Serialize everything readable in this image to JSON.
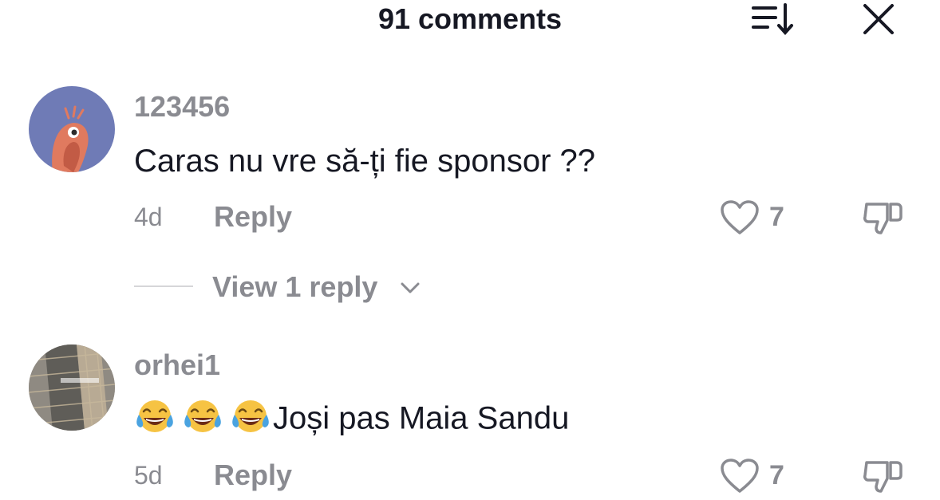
{
  "header": {
    "title": "91 comments",
    "sort_icon": "sort-down-icon",
    "close_icon": "close-icon"
  },
  "comments": [
    {
      "username": "123456",
      "text": "Caras nu vre să-ți fie sponsor ??",
      "time": "4d",
      "reply_label": "Reply",
      "likes": "7",
      "view_replies_label": "View 1 reply"
    },
    {
      "username": "orhei1",
      "emoji_count": 3,
      "emoji": "face-with-tears-of-joy",
      "text": "Joși pas Maia Sandu",
      "time": "5d",
      "reply_label": "Reply",
      "likes": "7"
    }
  ],
  "colors": {
    "text_primary": "#161823",
    "text_secondary": "#8a8b91",
    "avatar1_bg": "#6f7bb6",
    "avatar1_figure": "#e07a5f"
  }
}
